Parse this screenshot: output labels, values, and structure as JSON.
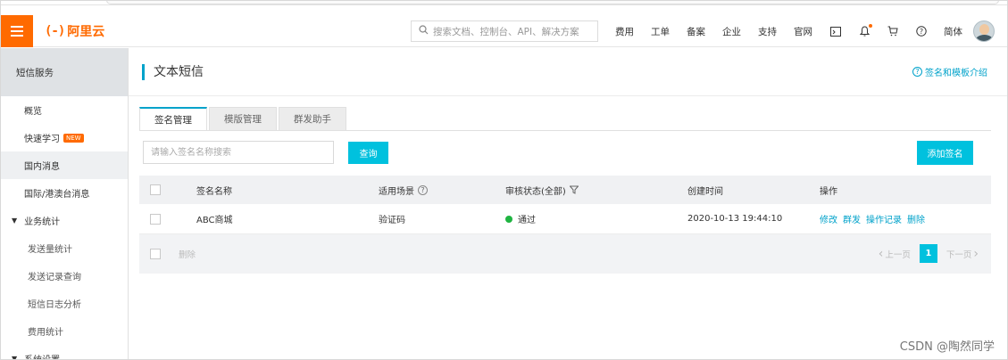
{
  "header": {
    "brand": "阿里云",
    "brand_mark": "(-)",
    "search_placeholder": "搜索文档、控制台、API、解决方案",
    "nav": [
      "费用",
      "工单",
      "备案",
      "企业",
      "支持",
      "官网"
    ],
    "lang": "简体",
    "accent": "#ff6a00"
  },
  "sidebar": {
    "title": "短信服务",
    "items": [
      {
        "label": "概览"
      },
      {
        "label": "快速学习",
        "badge": "NEW"
      },
      {
        "label": "国内消息"
      },
      {
        "label": "国际/港澳台消息"
      }
    ],
    "group": {
      "label": "业务统计",
      "children": [
        "发送量统计",
        "发送记录查询",
        "短信日志分析",
        "费用统计"
      ]
    },
    "next_group": "系统设置"
  },
  "page": {
    "title": "文本短信",
    "help": "签名和模板介绍"
  },
  "tabs": [
    "签名管理",
    "模版管理",
    "群发助手"
  ],
  "filter": {
    "placeholder": "请输入签名名称搜索",
    "query_button": "查询",
    "add_button": "添加签名"
  },
  "table": {
    "columns": [
      "签名名称",
      "适用场景",
      "审核状态(全部)",
      "创建时间",
      "操作"
    ],
    "rows": [
      {
        "name": "ABC商城",
        "scene": "验证码",
        "status": "通过",
        "created": "2020-10-13 19:44:10",
        "actions": [
          "修改",
          "群发",
          "操作记录",
          "删除"
        ]
      }
    ],
    "footer_delete": "删除",
    "pager": {
      "prev": "上一页",
      "current": "1",
      "next": "下一页"
    }
  },
  "watermark": "CSDN @陶然同学",
  "colors": {
    "primary": "#00c1de",
    "link": "#00a2ca",
    "success": "#1fb441"
  }
}
